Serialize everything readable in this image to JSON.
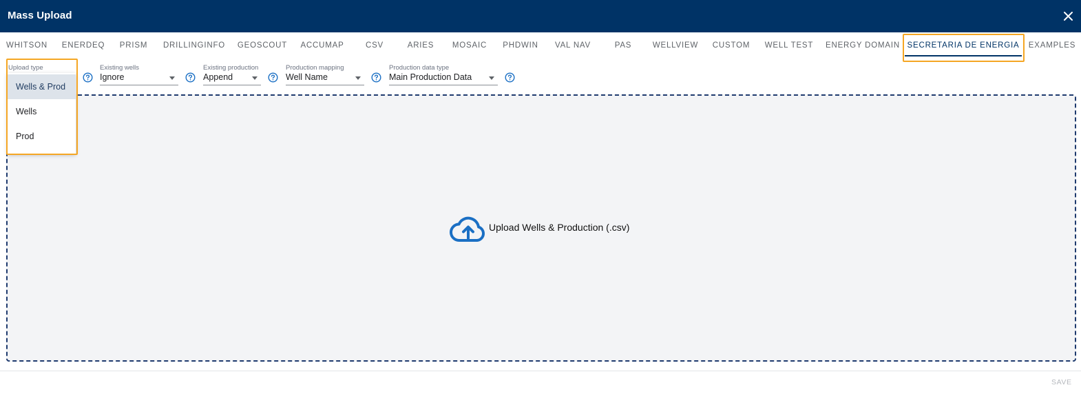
{
  "window": {
    "title": "Mass Upload",
    "close_icon": "close-icon"
  },
  "tabs": [
    {
      "label": "WHITSON"
    },
    {
      "label": "ENERDEQ"
    },
    {
      "label": "PRISM"
    },
    {
      "label": "DRILLINGINFO"
    },
    {
      "label": "GEOSCOUT"
    },
    {
      "label": "ACCUMAP"
    },
    {
      "label": "CSV"
    },
    {
      "label": "ARIES"
    },
    {
      "label": "MOSAIC"
    },
    {
      "label": "PHDWIN"
    },
    {
      "label": "VAL NAV"
    },
    {
      "label": "PAS"
    },
    {
      "label": "WELLVIEW"
    },
    {
      "label": "CUSTOM"
    },
    {
      "label": "WELL TEST"
    },
    {
      "label": "ENERGY DOMAIN"
    },
    {
      "label": "SECRETARIA DE ENERGIA",
      "active": true
    },
    {
      "label": "EXAMPLES"
    }
  ],
  "fields": {
    "upload_type": {
      "label": "Upload type"
    },
    "existing_wells": {
      "label": "Existing wells",
      "value": "Ignore"
    },
    "existing_production": {
      "label": "Existing production",
      "value": "Append"
    },
    "production_mapping": {
      "label": "Production mapping",
      "value": "Well Name"
    },
    "production_data_type": {
      "label": "Production data type",
      "value": "Main Production Data"
    }
  },
  "upload_type_menu": {
    "options": [
      "Wells & Prod",
      "Wells",
      "Prod"
    ],
    "selected": "Wells & Prod"
  },
  "dropzone": {
    "text": "Upload Wells & Production (.csv)",
    "icon": "cloud-upload-icon"
  },
  "footer": {
    "save_label": "SAVE"
  },
  "colors": {
    "header_bg": "#003366",
    "accent": "#003366",
    "highlight": "#f5a623",
    "icon_blue": "#1a6fc4",
    "dropzone_bg": "#f3f4f6"
  }
}
